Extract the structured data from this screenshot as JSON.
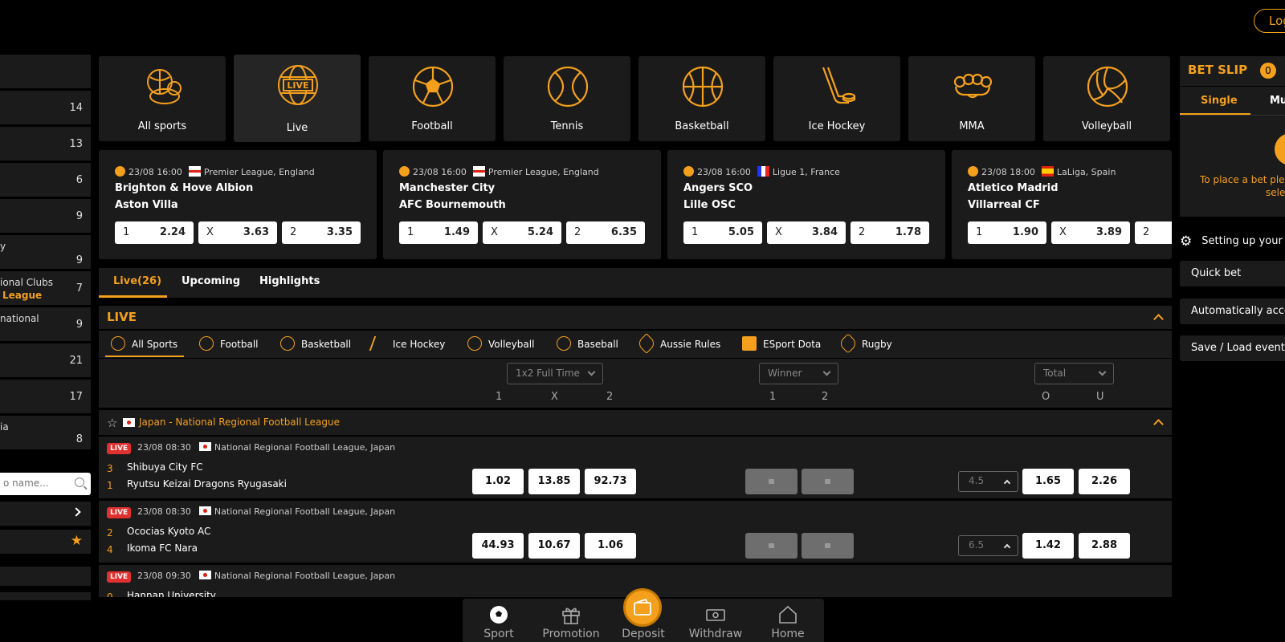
{
  "header": {
    "login_label": "Log"
  },
  "sidebar": {
    "rows": [
      {
        "label": "",
        "count": ""
      },
      {
        "label": "",
        "count": "14"
      },
      {
        "label": "",
        "count": "13"
      },
      {
        "label": "",
        "count": "6"
      },
      {
        "label": "",
        "count": "9"
      },
      {
        "label": "y",
        "count": "9"
      },
      {
        "label": "ional Clubs",
        "label2": "League",
        "count": "7"
      },
      {
        "label": "national",
        "count": "9"
      },
      {
        "label": "",
        "count": "21"
      },
      {
        "label": "",
        "count": "17"
      },
      {
        "label": "ia",
        "count": "8"
      }
    ],
    "search_placeholder": "o name..."
  },
  "sports": [
    {
      "label": "All sports",
      "icon": "all-sports-icon"
    },
    {
      "label": "Live",
      "icon": "live-icon"
    },
    {
      "label": "Football",
      "icon": "football-icon"
    },
    {
      "label": "Tennis",
      "icon": "tennis-icon"
    },
    {
      "label": "Basketball",
      "icon": "basketball-icon"
    },
    {
      "label": "Ice Hockey",
      "icon": "ice-hockey-icon"
    },
    {
      "label": "MMA",
      "icon": "mma-icon"
    },
    {
      "label": "Volleyball",
      "icon": "volleyball-icon"
    }
  ],
  "live_icon_text": "LIVE",
  "featured": [
    {
      "datetime": "23/08 16:00",
      "league": "Premier League, England",
      "home": "Brighton & Hove Albion",
      "away": "Aston Villa",
      "odds": [
        {
          "k": "1",
          "v": "2.24"
        },
        {
          "k": "X",
          "v": "3.63"
        },
        {
          "k": "2",
          "v": "3.35"
        }
      ]
    },
    {
      "datetime": "23/08 16:00",
      "league": "Premier League, England",
      "home": "Manchester City",
      "away": "AFC Bournemouth",
      "odds": [
        {
          "k": "1",
          "v": "1.49"
        },
        {
          "k": "X",
          "v": "5.24"
        },
        {
          "k": "2",
          "v": "6.35"
        }
      ]
    },
    {
      "datetime": "23/08 16:00",
      "league": "Ligue 1, France",
      "home": "Angers SCO",
      "away": "Lille OSC",
      "odds": [
        {
          "k": "1",
          "v": "5.05"
        },
        {
          "k": "X",
          "v": "3.84"
        },
        {
          "k": "2",
          "v": "1.78"
        }
      ]
    },
    {
      "datetime": "23/08 18:00",
      "league": "LaLiga, Spain",
      "home": "Atletico Madrid",
      "away": "Villarreal CF",
      "odds": [
        {
          "k": "1",
          "v": "1.90"
        },
        {
          "k": "X",
          "v": "3.89"
        },
        {
          "k": "2",
          "v": ""
        }
      ]
    }
  ],
  "tabs": [
    {
      "label": "Live(26)"
    },
    {
      "label": "Upcoming"
    },
    {
      "label": "Highlights"
    }
  ],
  "live_section": {
    "title": "LIVE",
    "sport_tabs": [
      "All Sports",
      "Football",
      "Basketball",
      "Ice Hockey",
      "Volleyball",
      "Baseball",
      "Aussie Rules",
      "ESport Dota",
      "Rugby"
    ],
    "markets": [
      {
        "label": "1x2 Full Time",
        "cols": [
          "1",
          "X",
          "2"
        ]
      },
      {
        "label": "Winner",
        "cols": [
          "1",
          "2"
        ]
      },
      {
        "label": "Total",
        "cols": [
          "O",
          "U"
        ]
      }
    ]
  },
  "league": {
    "name": "Japan - National Regional Football League"
  },
  "events": [
    {
      "badge": "LIVE",
      "datetime": "23/08 08:30",
      "league": "National Regional Football League, Japan",
      "score_home": "3",
      "score_away": "1",
      "home": "Shibuya City FC",
      "away": "Ryutsu Keizai Dragons Ryugasaki",
      "odds_1x2": [
        "1.02",
        "13.85",
        "92.73"
      ],
      "total_line": "4.5",
      "odds_ou": [
        "1.65",
        "2.26"
      ]
    },
    {
      "badge": "LIVE",
      "datetime": "23/08 08:30",
      "league": "National Regional Football League, Japan",
      "score_home": "2",
      "score_away": "4",
      "home": "Ococias Kyoto AC",
      "away": "Ikoma FC Nara",
      "odds_1x2": [
        "44.93",
        "10.67",
        "1.06"
      ],
      "total_line": "6.5",
      "odds_ou": [
        "1.42",
        "2.88"
      ]
    },
    {
      "badge": "LIVE",
      "datetime": "23/08 09:30",
      "league": "National Regional Football League, Japan",
      "score_home": "0",
      "home": "Hannan University"
    }
  ],
  "betslip": {
    "title": "BET SLIP",
    "count": "0",
    "tab_single": "Single",
    "tab_multi": "Mul",
    "message_line1": "To place a bet plea",
    "message_line2": "sele",
    "settings_label": "Setting up your b",
    "quick_bet": "Quick bet",
    "auto_accept": "Automatically accep",
    "save_load": "Save / Load events"
  },
  "bottom_nav": [
    {
      "label": "Sport",
      "icon": "soccer-ball-icon"
    },
    {
      "label": "Promotion",
      "icon": "gift-icon"
    },
    {
      "label": "Deposit",
      "icon": "wallet-icon"
    },
    {
      "label": "Withdraw",
      "icon": "cash-icon"
    },
    {
      "label": "Home",
      "icon": "home-icon"
    }
  ],
  "colors": {
    "accent": "#f4a01c",
    "panel": "#1b1b1b",
    "live_badge": "#e03030"
  }
}
